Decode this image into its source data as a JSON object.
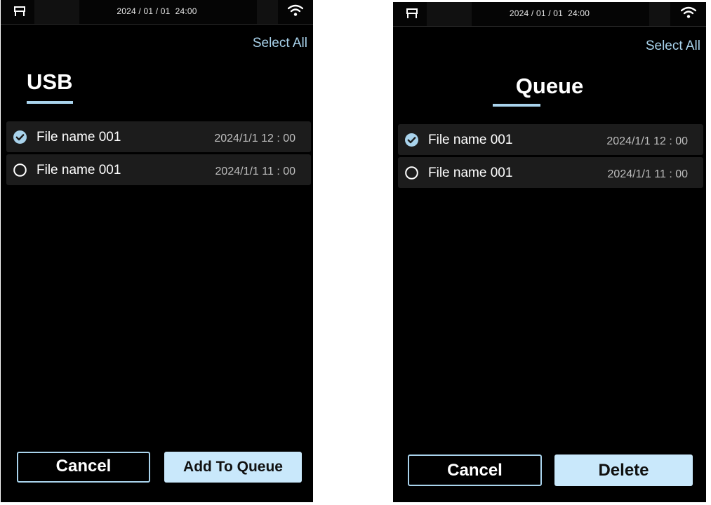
{
  "colors": {
    "background": "#000000",
    "accent": "#a9d3ec",
    "primary_button": "#c9e8fb",
    "row_background": "#1c1c1c",
    "status_bar": "#050505"
  },
  "screens": [
    {
      "id": "usb",
      "status_bar": {
        "date": "2024 / 01 / 01",
        "time": "24:00",
        "left_icon": "printer-icon",
        "right_icon": "wifi-icon"
      },
      "select_all_label": "Select All",
      "title": "USB",
      "files": [
        {
          "name": "File name 001",
          "date": "2024/1/1 12 : 00",
          "selected": true
        },
        {
          "name": "File name 001",
          "date": "2024/1/1 11 : 00",
          "selected": false
        }
      ],
      "cancel_label": "Cancel",
      "primary_label": "Add To Queue"
    },
    {
      "id": "queue",
      "status_bar": {
        "date": "2024 / 01 / 01",
        "time": "24:00",
        "left_icon": "printer-icon",
        "right_icon": "wifi-icon"
      },
      "select_all_label": "Select All",
      "title": "Queue",
      "files": [
        {
          "name": "File name 001",
          "date": "2024/1/1 12 : 00",
          "selected": true
        },
        {
          "name": "File name 001",
          "date": "2024/1/1 11 : 00",
          "selected": false
        }
      ],
      "cancel_label": "Cancel",
      "primary_label": "Delete"
    }
  ]
}
